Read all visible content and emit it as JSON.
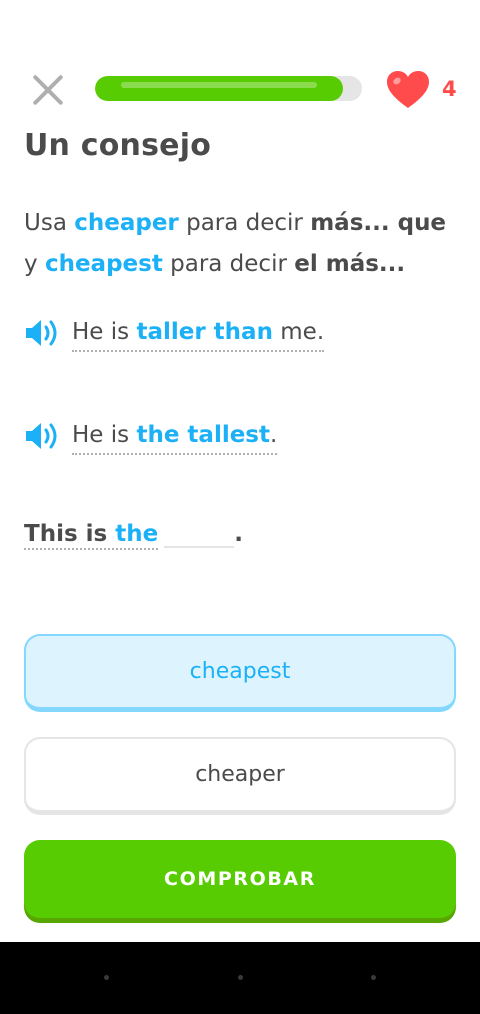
{
  "header": {
    "progress_fraction": 0.93,
    "hearts_count": "4"
  },
  "colors": {
    "accent_blue": "#1cb0f6",
    "progress_green": "#58cc02",
    "heart_red": "#ff4b4b"
  },
  "lesson": {
    "title": "Un consejo",
    "tip": {
      "p1": "Usa ",
      "word1": "cheaper",
      "p2": " para decir ",
      "bold1": "más... que",
      "p3": "y ",
      "word2": "cheapest",
      "p4": " para decir ",
      "bold2": "el más..."
    },
    "examples": [
      {
        "pre": "He is ",
        "highlight": "taller than",
        "post": " me.",
        "icon": "speaker-icon"
      },
      {
        "pre": "He is ",
        "highlight": "the tallest",
        "post": ".",
        "icon": "speaker-icon"
      }
    ],
    "exercise": {
      "lead": "This is ",
      "lead_blue": "the",
      "end": "."
    },
    "options": [
      {
        "label": "cheapest",
        "selected": true
      },
      {
        "label": "cheaper",
        "selected": false
      }
    ],
    "check_label": "COMPROBAR"
  }
}
